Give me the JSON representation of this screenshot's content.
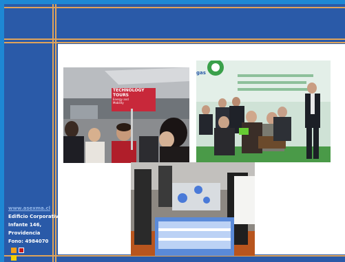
{
  "sidebar": {
    "website": "www.asexma.cl",
    "address_lines": [
      "Edificio Corporativo",
      "Infante 146,",
      "Providencia",
      "Fono: 4984070"
    ]
  },
  "photos": {
    "tour_sign": {
      "line1": "TECHNOLOGY",
      "line2": "TOURS",
      "line3": "Energy and",
      "line4": "Mobility"
    }
  },
  "colors": {
    "background": "#1e88d4",
    "frame": "#2a5aa8",
    "accent": "#e0a45a",
    "content": "#ffffff",
    "square_orange": "#f2a01a",
    "square_red": "#c0181a",
    "square_yellow": "#f5d000"
  }
}
